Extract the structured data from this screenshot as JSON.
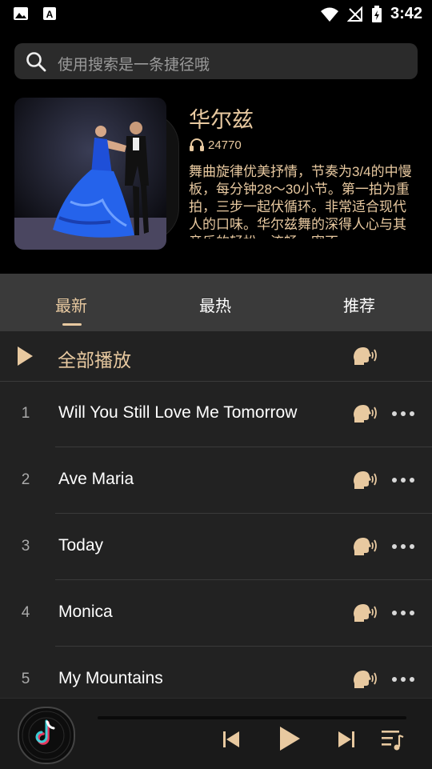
{
  "status_bar": {
    "time": "3:42"
  },
  "search": {
    "placeholder": "使用搜索是一条捷径哦"
  },
  "playlist": {
    "title": "华尔兹",
    "listen_count": "24770",
    "description": "舞曲旋律优美抒情，节奏为3/4的中慢板，每分钟28～30小节。第一拍为重拍，三步一起伏循环。非常适合现代人的口味。华尔兹舞的深得人心与其音乐的轻松、流畅、密不"
  },
  "tabs": [
    {
      "label": "最新"
    },
    {
      "label": "最热"
    },
    {
      "label": "推荐"
    }
  ],
  "play_all": {
    "label": "全部播放"
  },
  "songs": [
    {
      "index": "1",
      "title": "Will You Still Love Me Tomorrow"
    },
    {
      "index": "2",
      "title": "Ave Maria"
    },
    {
      "index": "3",
      "title": "Today"
    },
    {
      "index": "4",
      "title": "Monica"
    },
    {
      "index": "5",
      "title": "My Mountains"
    }
  ],
  "colors": {
    "accent": "#e8c9a0",
    "background": "#000000",
    "list_bg": "#222222",
    "tab_bg": "#3a3a3a"
  },
  "icons": {
    "search": "search-icon",
    "headphones": "headphones-icon",
    "play": "play-icon",
    "speaking_head": "speaking-head-icon",
    "more": "more-dots-icon",
    "previous": "skip-previous-icon",
    "next": "skip-next-icon",
    "playlist": "playlist-icon",
    "tiktok": "tiktok-icon"
  }
}
